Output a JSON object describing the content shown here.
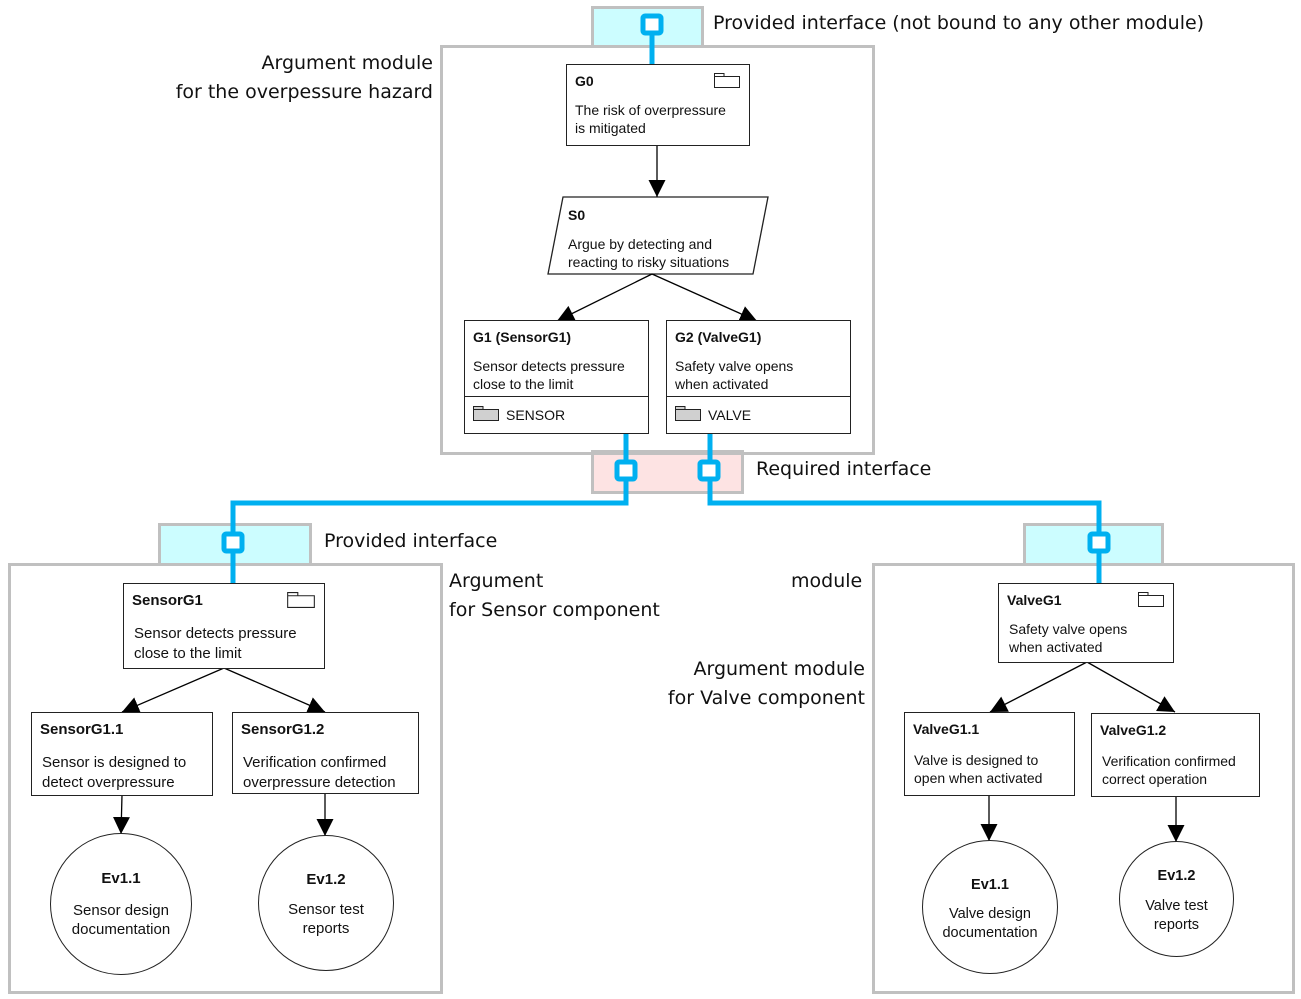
{
  "colors": {
    "interface_line": "#00b0f0",
    "provided_fill": "#ccfdff",
    "required_fill": "#fde3e3",
    "module_border": "#c0c0c0"
  },
  "captions": {
    "top_provided": "Provided interface (not bound to any other module)",
    "top_module_line1": "Argument module",
    "top_module_line2": "for the overpessure hazard",
    "required": "Required interface",
    "sensor_provided": "Provided interface",
    "sensor_module_line1": "Argument",
    "sensor_module_line2": "for Sensor component",
    "stray_module": "module",
    "valve_module_line1": "Argument module",
    "valve_module_line2": "for Valve component"
  },
  "top_module": {
    "g0": {
      "id": "G0",
      "text": "The risk of overpressure\nis mitigated",
      "icon": "module-folder-icon"
    },
    "s0": {
      "id": "S0",
      "text": "Argue by detecting and\nreacting to risky situations"
    },
    "g1": {
      "id": "G1 (SensorG1)",
      "text": "Sensor detects pressure\nclose to the limit",
      "module_ref": "SENSOR",
      "icon": "module-folder-icon"
    },
    "g2": {
      "id": "G2 (ValveG1)",
      "text": "Safety valve opens\nwhen activated",
      "module_ref": "VALVE",
      "icon": "module-folder-icon"
    }
  },
  "sensor_module": {
    "root": {
      "id": "SensorG1",
      "text": "Sensor detects pressure\nclose to the limit"
    },
    "g11": {
      "id": "SensorG1.1",
      "text": "Sensor is designed to\ndetect overpressure"
    },
    "g12": {
      "id": "SensorG1.2",
      "text": "Verification confirmed\noverpressure detection"
    },
    "ev11": {
      "id": "Ev1.1",
      "text": "Sensor design\ndocumentation"
    },
    "ev12": {
      "id": "Ev1.2",
      "text": "Sensor test\nreports"
    }
  },
  "valve_module": {
    "root": {
      "id": "ValveG1",
      "text": "Safety valve opens\nwhen activated"
    },
    "g11": {
      "id": "ValveG1.1",
      "text": "Valve is designed to\nopen when activated"
    },
    "g12": {
      "id": "ValveG1.2",
      "text": "Verification confirmed\ncorrect operation"
    },
    "ev11": {
      "id": "Ev1.1",
      "text": "Valve design\ndocumentation"
    },
    "ev12": {
      "id": "Ev1.2",
      "text": "Valve test\nreports"
    }
  }
}
